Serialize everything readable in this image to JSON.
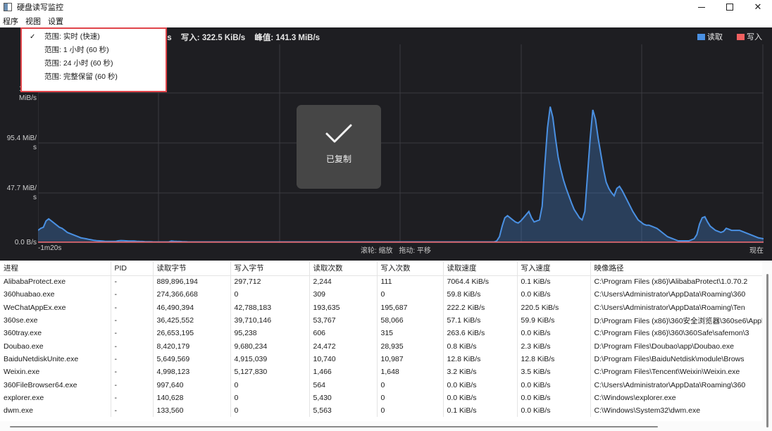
{
  "window": {
    "title": "硬盘读写监控"
  },
  "menu": [
    "程序",
    "视图",
    "设置"
  ],
  "stats": {
    "read_prefix": "/s",
    "write": "写入: 322.5 KiB/s",
    "peak": "峰值: 141.3 MiB/s"
  },
  "legend": {
    "read": {
      "label": "读取",
      "color": "#4a90e2"
    },
    "write": {
      "label": "写入",
      "color": "#f06060"
    }
  },
  "chart_data": {
    "type": "area",
    "title": "",
    "xlabel": "",
    "ylabel": "",
    "x_start_label": "-1m20s",
    "x_end_label": "现在",
    "y_ticks": [
      "0.0 B/s",
      "47.7 MiB/\ns",
      "95.4 MiB/\ns",
      "143.1\nMiB/s"
    ],
    "ylim": [
      0,
      143.1
    ],
    "y_unit": "MiB/s",
    "series": [
      {
        "name": "读取",
        "values": [
          12,
          14,
          15,
          21,
          23,
          21,
          19,
          17,
          15,
          14,
          12,
          10,
          9,
          8,
          7,
          6,
          5,
          4.5,
          4,
          3.5,
          3,
          2.5,
          2.2,
          2,
          1.8,
          1.6,
          1.5,
          1.5,
          1.5,
          1.5,
          2,
          2.3,
          2.2,
          2,
          1.8,
          1.8,
          1.8,
          1.6,
          1.5,
          1.4,
          1.3,
          1.2,
          1.2,
          1.1,
          1,
          1,
          1,
          1,
          1,
          1,
          1.8,
          1.6,
          1.5,
          1.4,
          1.3,
          1.2,
          1.1,
          1,
          1,
          1,
          1,
          1,
          1,
          1,
          1,
          1,
          1,
          1,
          1,
          1,
          1,
          1,
          1,
          1,
          1,
          1,
          1,
          1,
          1,
          1,
          1,
          1,
          1,
          1,
          1,
          1,
          1,
          1,
          1,
          1,
          1,
          1,
          1,
          1,
          1,
          1,
          1,
          1,
          1,
          1,
          1,
          1,
          1,
          1,
          1,
          1,
          1,
          1,
          1,
          1,
          1,
          1,
          1,
          1,
          1,
          1,
          1,
          1,
          1,
          1,
          1,
          1,
          1,
          1,
          1,
          1,
          1,
          1,
          1,
          1,
          1,
          1,
          1,
          1,
          1,
          1,
          1,
          1,
          1,
          1,
          1,
          1,
          1,
          1,
          1,
          1,
          1,
          1,
          1,
          1,
          1,
          1,
          1,
          1,
          1,
          1,
          1,
          1,
          1,
          1,
          1,
          1,
          1,
          1,
          1,
          1,
          1,
          1,
          1,
          1,
          1,
          1,
          2,
          6,
          16,
          24,
          26,
          24,
          22,
          20,
          19,
          21,
          24,
          27,
          30,
          24,
          20,
          21,
          22,
          35,
          75,
          110,
          130,
          120,
          100,
          82,
          70,
          60,
          52,
          45,
          38,
          32,
          28,
          24,
          22,
          30,
          65,
          100,
          127,
          118,
          100,
          85,
          70,
          58,
          52,
          48,
          45,
          52,
          54,
          50,
          45,
          40,
          35,
          30,
          26,
          22,
          20,
          18,
          17,
          17,
          16,
          15,
          14,
          12,
          10,
          8,
          6,
          5,
          4,
          3,
          2,
          2,
          2,
          2,
          2,
          3,
          4,
          8,
          18,
          24,
          25,
          20,
          16,
          14,
          12,
          11,
          10,
          11,
          14,
          13,
          12,
          12,
          12,
          12,
          11,
          10,
          9,
          8,
          7,
          6,
          5,
          4.5,
          4
        ]
      },
      {
        "name": "写入",
        "values": [
          0.8,
          0.8,
          0.8,
          0.8,
          0.8,
          0.8,
          0.8,
          0.8,
          0.8,
          0.8,
          0.8,
          0.8,
          0.8,
          0.8,
          0.8,
          0.8,
          0.8,
          0.8,
          0.8,
          0.8,
          0.8,
          0.8,
          0.8,
          0.8,
          0.8,
          0.8,
          0.8,
          0.8,
          0.8,
          0.8,
          0.8,
          0.8,
          0.8,
          0.8,
          0.8,
          0.8,
          0.8,
          0.8,
          0.8,
          0.8,
          0.8,
          0.8,
          0.8,
          0.8,
          0.8,
          0.8,
          0.8,
          0.8,
          0.8,
          0.8,
          0.8,
          0.8,
          0.8,
          0.8,
          0.8,
          0.8,
          0.8,
          0.8,
          0.8,
          0.8,
          0.8,
          0.8,
          0.8,
          0.8,
          0.8,
          0.8,
          0.8,
          0.8,
          0.8,
          0.8,
          0.8,
          0.8,
          0.8,
          0.8,
          0.8,
          0.8,
          0.8,
          0.8,
          0.8,
          0.8,
          0.8,
          0.8,
          0.8,
          0.8,
          0.8,
          0.8,
          0.8,
          0.8,
          0.8,
          0.8,
          0.8,
          0.8,
          0.8,
          0.8,
          0.8,
          0.8,
          0.8,
          0.8,
          0.8,
          0.8,
          0.8,
          0.8,
          0.8,
          0.8,
          0.8,
          0.8,
          0.8,
          0.8,
          0.8,
          0.8,
          0.8,
          0.8,
          0.8,
          0.8,
          0.8,
          0.8,
          0.8,
          0.8,
          0.8,
          0.8,
          0.8,
          0.8,
          0.8,
          0.8,
          0.8,
          0.8,
          0.8,
          0.8,
          0.8,
          0.8,
          0.8,
          0.8,
          0.8,
          0.8,
          0.8,
          0.8,
          0.8,
          0.8,
          0.8,
          0.8,
          0.8,
          0.8,
          0.8,
          0.8,
          0.8,
          0.8,
          0.8,
          0.8,
          0.8,
          0.8,
          0.8,
          0.8,
          0.8,
          0.8,
          0.8,
          0.8,
          0.8,
          0.8,
          0.8,
          0.8,
          0.8,
          0.8,
          0.8,
          0.8,
          0.8,
          0.8,
          0.8,
          0.8,
          0.8,
          0.8,
          0.8,
          0.8,
          0.8,
          0.8,
          0.8,
          0.8,
          0.8,
          0.8,
          0.8,
          0.8,
          0.8,
          0.8,
          0.8,
          0.8,
          0.8,
          0.8,
          0.8,
          0.8,
          0.8,
          0.8,
          0.8,
          0.8,
          0.8,
          0.8,
          0.8,
          0.8,
          0.8,
          0.8,
          0.8,
          0.8,
          0.8,
          0.8,
          0.8,
          0.8,
          0.8,
          0.8,
          0.8,
          0.8,
          0.8,
          0.8,
          0.8,
          0.8,
          0.8,
          0.8,
          0.8,
          0.8,
          0.8,
          0.8,
          0.8,
          0.8,
          0.8,
          0.8,
          0.8,
          0.8,
          0.8,
          0.8,
          0.8,
          0.8,
          0.8,
          0.8,
          0.8,
          0.8,
          0.8,
          0.8,
          0.8,
          0.8,
          0.8,
          0.8,
          0.8,
          0.8,
          0.8,
          0.8,
          0.8,
          0.8,
          0.8,
          0.8,
          0.8,
          0.8,
          0.8,
          0.8,
          0.8,
          0.8,
          0.8,
          0.8,
          0.8,
          0.8,
          0.8,
          0.8,
          0.8,
          0.8,
          0.8,
          0.8,
          0.8,
          0.8,
          0.8,
          0.8,
          0.8,
          0.8,
          0.8,
          0.8,
          0.8
        ]
      }
    ],
    "grid": true,
    "legend_position": "top-right"
  },
  "hints": [
    "滚轮: 缩放",
    "拖动: 平移"
  ],
  "toast": {
    "text": "已复制"
  },
  "dropdown": {
    "items": [
      {
        "label": "范围: 实时 (快速)",
        "checked": true
      },
      {
        "label": "范围: 1 小时 (60 秒)",
        "checked": false
      },
      {
        "label": "范围: 24 小时 (60 秒)",
        "checked": false
      },
      {
        "label": "范围: 完整保留 (60 秒)",
        "checked": false
      }
    ],
    "check_glyph": "✓"
  },
  "table": {
    "headers": [
      "进程",
      "PID",
      "读取字节",
      "写入字节",
      "读取次数",
      "写入次数",
      "读取速度",
      "写入速度",
      "映像路径"
    ],
    "rows": [
      [
        "AlibabaProtect.exe",
        "-",
        "889,896,194",
        "297,712",
        "2,244",
        "111",
        "7064.4 KiB/s",
        "0.1 KiB/s",
        "C:\\Program Files (x86)\\AlibabaProtect\\1.0.70.2"
      ],
      [
        "360huabao.exe",
        "-",
        "274,366,668",
        "0",
        "309",
        "0",
        "59.8 KiB/s",
        "0.0 KiB/s",
        "C:\\Users\\Administrator\\AppData\\Roaming\\360"
      ],
      [
        "WeChatAppEx.exe",
        "-",
        "46,490,394",
        "42,788,183",
        "193,635",
        "195,687",
        "222.2 KiB/s",
        "220.5 KiB/s",
        "C:\\Users\\Administrator\\AppData\\Roaming\\Ten"
      ],
      [
        "360se.exe",
        "-",
        "36,425,552",
        "39,710,146",
        "53,767",
        "58,066",
        "57.1 KiB/s",
        "59.9 KiB/s",
        "D:\\Program Files (x86)\\360安全浏览器\\360se6\\Applic"
      ],
      [
        "360tray.exe",
        "-",
        "26,653,195",
        "95,238",
        "606",
        "315",
        "263.6 KiB/s",
        "0.0 KiB/s",
        "C:\\Program Files (x86)\\360\\360Safe\\safemon\\3"
      ],
      [
        "Doubao.exe",
        "-",
        "8,420,179",
        "9,680,234",
        "24,472",
        "28,935",
        "0.8 KiB/s",
        "2.3 KiB/s",
        "D:\\Program Files\\Doubao\\app\\Doubao.exe"
      ],
      [
        "BaiduNetdiskUnite.exe",
        "-",
        "5,649,569",
        "4,915,039",
        "10,740",
        "10,987",
        "12.8 KiB/s",
        "12.8 KiB/s",
        "D:\\Program Files\\BaiduNetdisk\\module\\Brows"
      ],
      [
        "Weixin.exe",
        "-",
        "4,998,123",
        "5,127,830",
        "1,466",
        "1,648",
        "3.2 KiB/s",
        "3.5 KiB/s",
        "C:\\Program Files\\Tencent\\Weixin\\Weixin.exe"
      ],
      [
        "360FileBrowser64.exe",
        "-",
        "997,640",
        "0",
        "564",
        "0",
        "0.0 KiB/s",
        "0.0 KiB/s",
        "C:\\Users\\Administrator\\AppData\\Roaming\\360"
      ],
      [
        "explorer.exe",
        "-",
        "140,628",
        "0",
        "5,430",
        "0",
        "0.0 KiB/s",
        "0.0 KiB/s",
        "C:\\Windows\\explorer.exe"
      ],
      [
        "dwm.exe",
        "-",
        "133,560",
        "0",
        "5,563",
        "0",
        "0.1 KiB/s",
        "0.0 KiB/s",
        "C:\\Windows\\System32\\dwm.exe"
      ]
    ]
  }
}
